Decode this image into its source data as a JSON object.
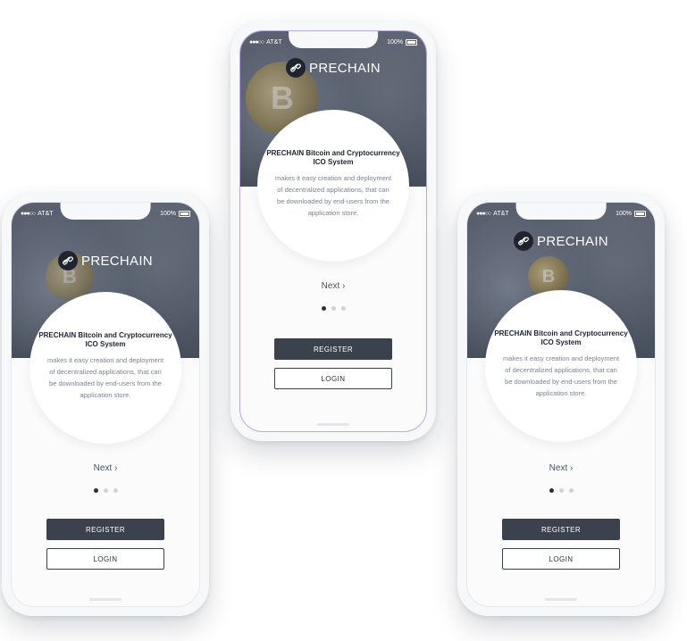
{
  "colors": {
    "dark": "#3b414d",
    "hero": "#505766",
    "accent_active_dot": "#2b303b"
  },
  "status": {
    "carrier": "AT&T",
    "battery": "100%"
  },
  "brand": {
    "name": "PRECHAIN"
  },
  "onboarding": {
    "title": "PRECHAIN Bitcoin and Cryptocurrency ICO System",
    "description": "makes it easy creation and deployment of decentralized applications, that can be downloaded by end-users from the application store.",
    "next_label": "Next",
    "next_icon": "chevron-right-icon",
    "pager": {
      "pages": 3,
      "active": 1
    }
  },
  "buttons": {
    "register": "REGISTER",
    "login": "LOGIN"
  },
  "hero_image": {
    "coin_symbol": "B"
  }
}
